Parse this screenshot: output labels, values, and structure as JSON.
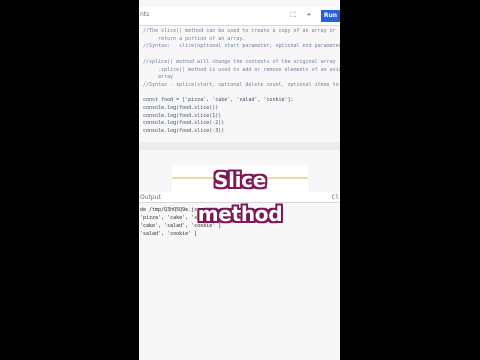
{
  "toolbar": {
    "file_tab": "nts",
    "expand_icon": "expand-icon",
    "theme_icon": "theme-icon",
    "run_label": "Run"
  },
  "editor": {
    "lines": [
      "//The slice() method can be used to create a copy of an array or",
      "     return a portion of an array.",
      "//Syntax:   slice(optional start parameter, optional end parameter)",
      "",
      "//splice() method will change the contents of the original array",
      "     .splice() method is used to add or remove elements of an existi",
      "     array",
      "//Syntax - splice(start, optional delete count, optional items to ad",
      "",
      "const food = ['pizza', 'cake', 'salad', 'cookie'];",
      "console.log(food.slice())",
      "console.log(food.slice(1))",
      "console.log(food.slice(-2))",
      "console.log(food.slice(-3))"
    ]
  },
  "output": {
    "label": "Output",
    "right_label": "Cl"
  },
  "console": {
    "lines": [
      "de /tmp/Q3hQ5Q9e.js",
      "'pizza', 'cake', 'salad', 'cookie' ]",
      "'cake', 'salad', 'cookie' ]",
      "'salad', 'cookie' ]"
    ]
  },
  "overlay": {
    "title": "Slice method",
    "outline_color": "#7e1857"
  }
}
